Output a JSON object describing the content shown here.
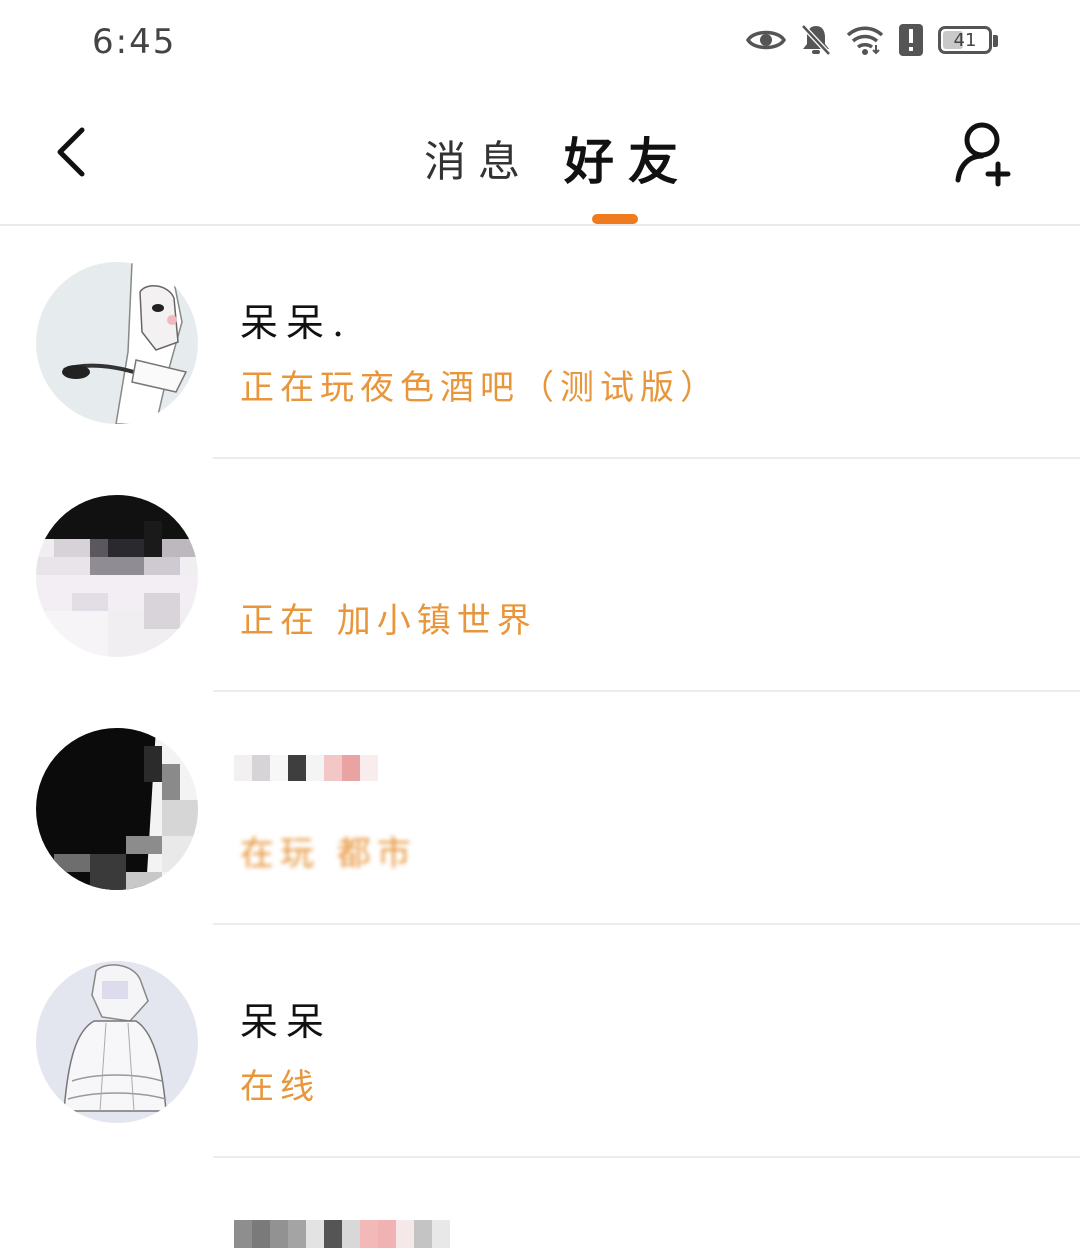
{
  "status_bar": {
    "time": "6:45",
    "battery_level": "41",
    "icons": [
      "eye-icon",
      "bell-muted-icon",
      "wifi-icon",
      "alert-icon",
      "battery-icon"
    ]
  },
  "nav": {
    "back_icon": "chevron-left-icon",
    "tabs": [
      {
        "label": "消息",
        "active": false
      },
      {
        "label": "好友",
        "active": true
      }
    ],
    "add_friend_icon": "add-user-icon",
    "accent_color": "#f07a20"
  },
  "friends": [
    {
      "name": "呆呆.",
      "status": "正在玩夜色酒吧（测试版）"
    },
    {
      "name": "",
      "status": "正在 加小镇世界"
    },
    {
      "name": "",
      "status": "在玩 都市"
    },
    {
      "name": "呆呆",
      "status": "在线"
    }
  ],
  "colors": {
    "status_text": "#e8963c",
    "divider": "#ececec"
  }
}
